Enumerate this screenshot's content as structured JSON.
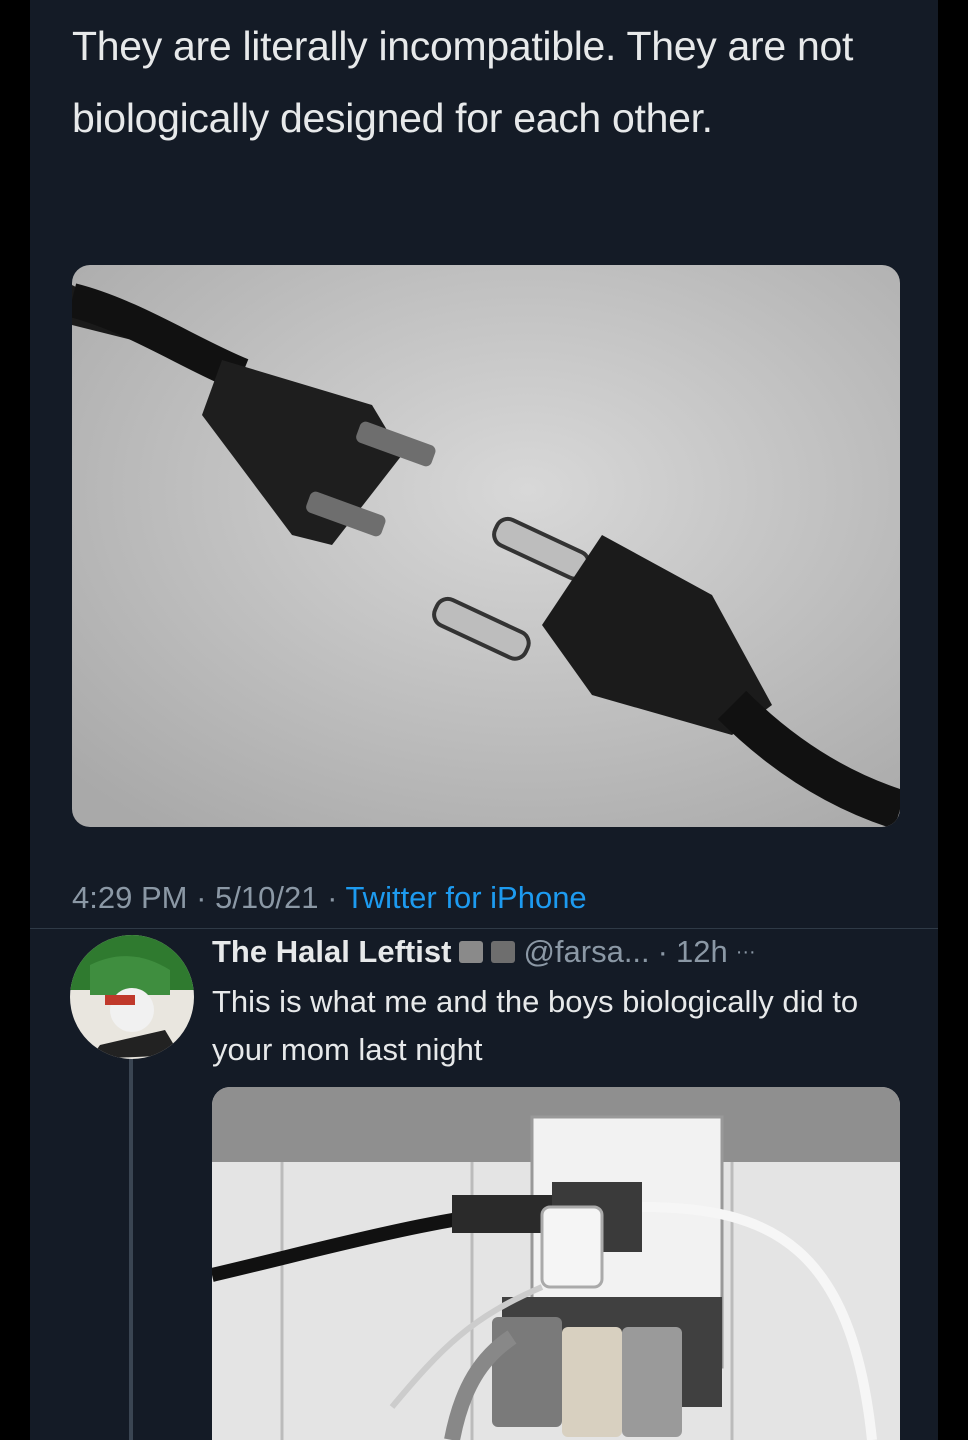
{
  "tweet": {
    "text": "They are literally incompatible. They are not biologically designed for each other.",
    "image_icon": "incompatible-plugs-photo",
    "time": "4:29 PM",
    "sep1": " · ",
    "date": "5/10/21",
    "sep2": " · ",
    "client": "Twitter for iPhone"
  },
  "reply": {
    "name": "The Halal Leftist",
    "handle": "@farsa...",
    "time_sep": " ·",
    "time": "12h",
    "more": "···",
    "text": "This is what me and the boys biologically did to your mom last night",
    "image_icon": "overloaded-power-outlet-photo"
  },
  "colors": {
    "background": "#141b26",
    "text": "#e7e9ea",
    "muted": "#8b98a5",
    "link": "#1d9bf0"
  }
}
